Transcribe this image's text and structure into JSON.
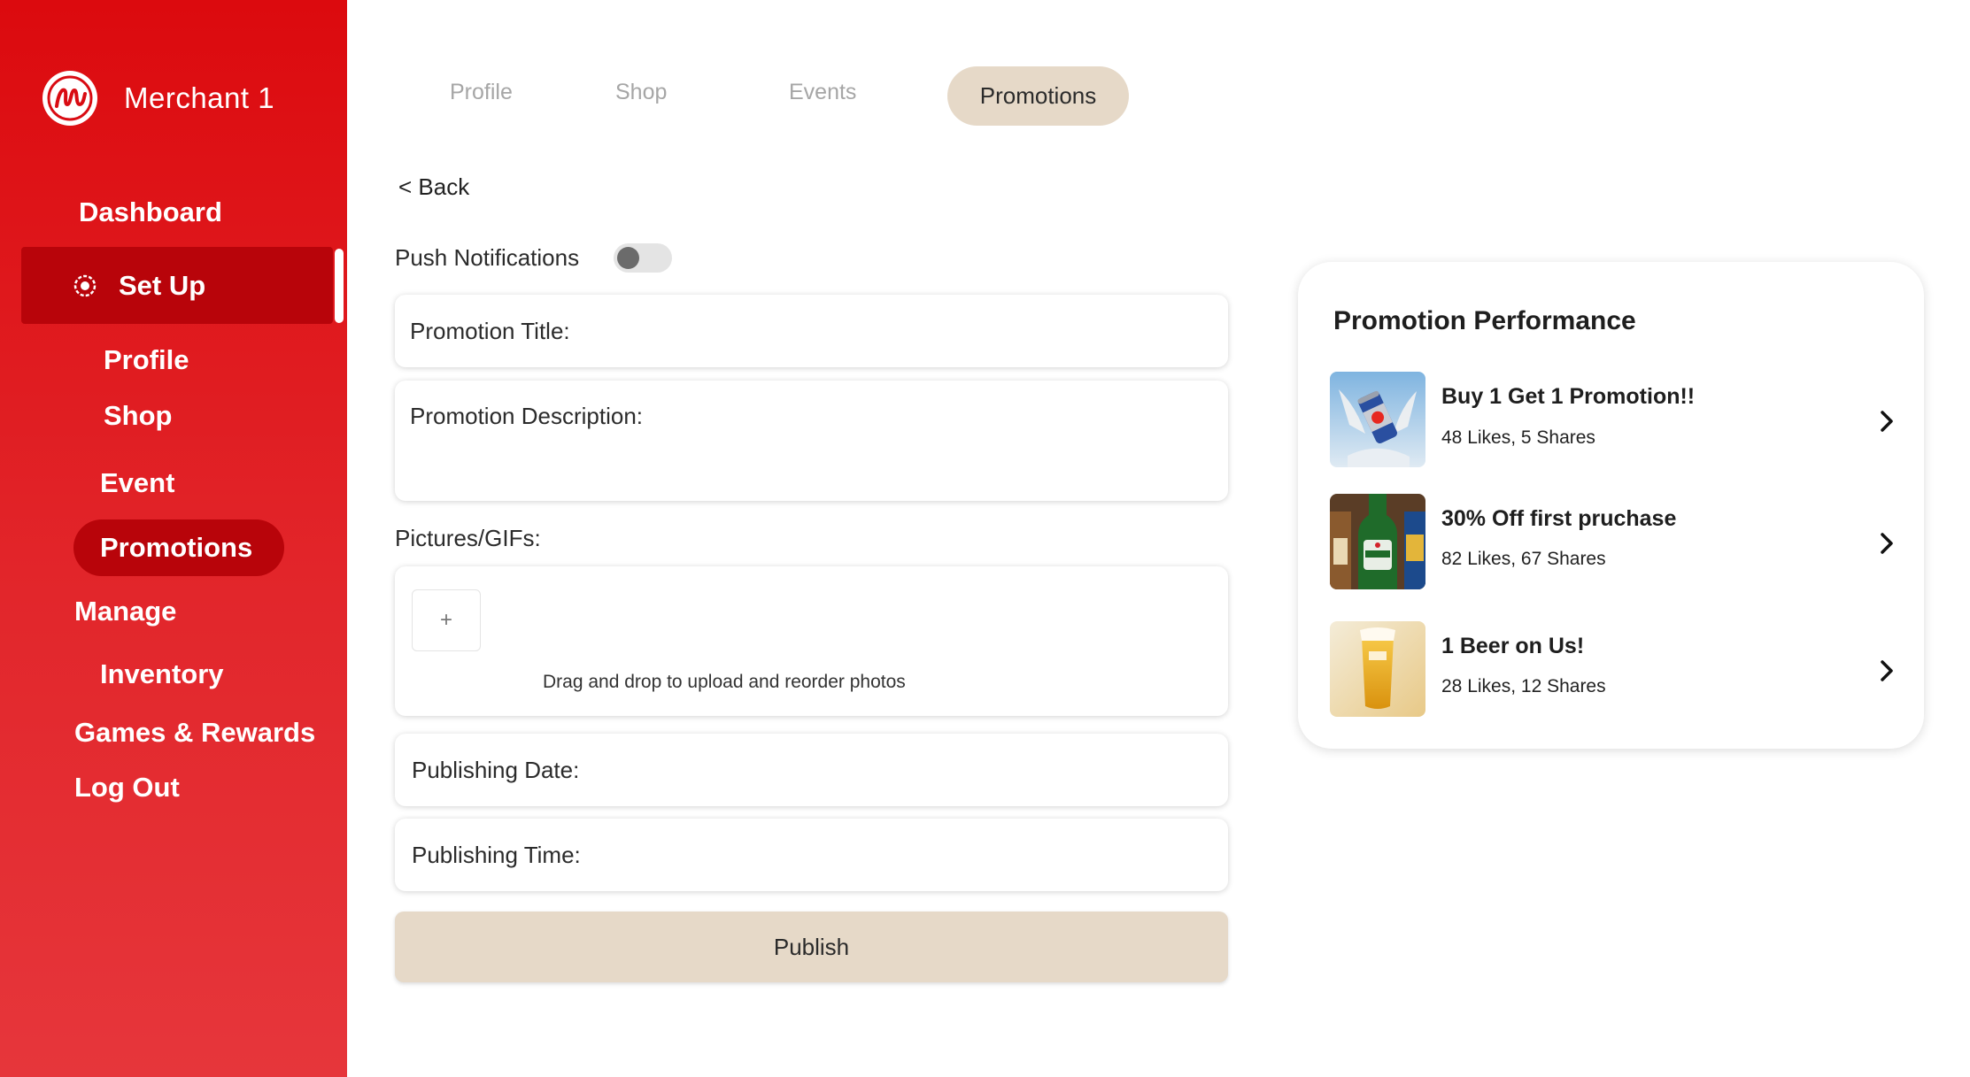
{
  "sidebar": {
    "merchant_name": "Merchant 1",
    "nav": {
      "dashboard": "Dashboard",
      "setup": "Set Up",
      "profile": "Profile",
      "shop": "Shop",
      "event": "Event",
      "promotions": "Promotions",
      "manage": "Manage",
      "inventory": "Inventory",
      "games_rewards": "Games & Rewards",
      "logout": "Log Out"
    }
  },
  "tabs": {
    "profile": "Profile",
    "shop": "Shop",
    "events": "Events",
    "promotions": "Promotions"
  },
  "form": {
    "back": "< Back",
    "push_notifications": "Push Notifications",
    "promotion_title": "Promotion Title:",
    "promotion_description": "Promotion Description:",
    "pictures_label": "Pictures/GIFs:",
    "add_symbol": "+",
    "drop_hint": "Drag and drop to upload and reorder photos",
    "publishing_date": "Publishing Date:",
    "publishing_time": "Publishing Time:",
    "publish": "Publish"
  },
  "performance": {
    "title": "Promotion Performance",
    "items": [
      {
        "name": "Buy 1 Get 1 Promotion!!",
        "stats": "48 Likes, 5 Shares"
      },
      {
        "name": "30% Off first pruchase",
        "stats": "82 Likes, 67 Shares"
      },
      {
        "name": "1 Beer on Us!",
        "stats": "28 Likes, 12 Shares"
      }
    ]
  },
  "colors": {
    "sidebar_red": "#dc0a0e",
    "sidebar_active": "#b8040a",
    "accent_beige": "#e6d9c8"
  }
}
